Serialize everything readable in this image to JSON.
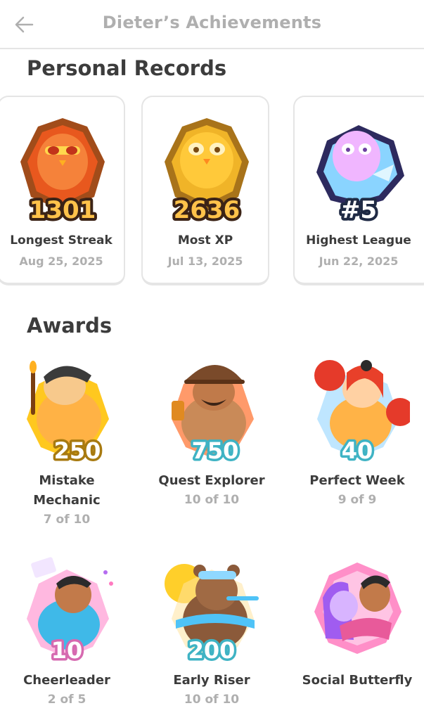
{
  "header": {
    "title": "Dieter’s Achievements",
    "back_icon": "arrow-left-icon"
  },
  "records": {
    "heading": "Personal Records",
    "items": [
      {
        "value": "1301",
        "label": "Longest Streak",
        "date": "Aug 25, 2025",
        "icon": "streak-owl-badge"
      },
      {
        "value": "2636",
        "label": "Most XP",
        "date": "Jul 13, 2025",
        "icon": "xp-owl-badge"
      },
      {
        "value": "#5",
        "label": "Highest League",
        "date": "Jun 22, 2025",
        "icon": "league-owl-badge"
      }
    ]
  },
  "awards": {
    "heading": "Awards",
    "items": [
      {
        "value": "250",
        "name_line1": "Mistake",
        "name_line2": "Mechanic",
        "progress": "7 of 10",
        "icon": "welder-character-badge"
      },
      {
        "value": "750",
        "name_line1": "Quest Explorer",
        "name_line2": "",
        "progress": "10 of 10",
        "icon": "explorer-character-badge"
      },
      {
        "value": "40",
        "name_line1": "Perfect Week",
        "name_line2": "",
        "progress": "9 of 9",
        "icon": "boxer-character-badge"
      },
      {
        "value": "10",
        "name_line1": "Cheerleader",
        "name_line2": "",
        "progress": "2 of 5",
        "icon": "cheerleader-character-badge"
      },
      {
        "value": "200",
        "name_line1": "Early Riser",
        "name_line2": "",
        "progress": "10 of 10",
        "icon": "bear-character-badge"
      },
      {
        "value": "",
        "name_line1": "Social Butterfly",
        "name_line2": "",
        "progress": "",
        "icon": "friends-hug-badge"
      }
    ]
  },
  "colors": {
    "title_gray": "#afafaf",
    "heading": "#3c3c3c",
    "border": "#e5e5e5"
  }
}
